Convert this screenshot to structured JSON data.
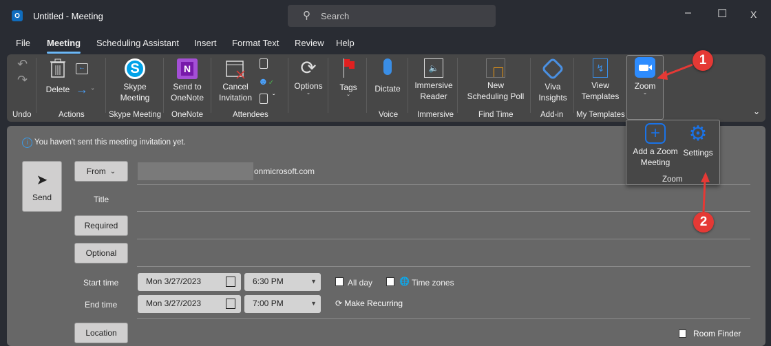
{
  "window": {
    "title": "Untitled  -  Meeting",
    "search_placeholder": "Search",
    "minimize": "–",
    "maximize": "☐",
    "close": "X"
  },
  "tabs": [
    {
      "label": "File"
    },
    {
      "label": "Meeting",
      "active": true
    },
    {
      "label": "Scheduling Assistant"
    },
    {
      "label": "Insert"
    },
    {
      "label": "Format Text"
    },
    {
      "label": "Review"
    },
    {
      "label": "Help"
    }
  ],
  "ribbon": {
    "groups": {
      "undo": "Undo",
      "actions": "Actions",
      "skype": "Skype Meeting",
      "onenote": "OneNote",
      "attendees": "Attendees",
      "voice": "Voice",
      "immersive": "Immersive",
      "findtime": "Find Time",
      "addin": "Add-in",
      "templates": "My Templates"
    },
    "buttons": {
      "delete": "Delete",
      "skype1": "Skype",
      "skype2": "Meeting",
      "onenote1": "Send to",
      "onenote2": "OneNote",
      "cancel1": "Cancel",
      "cancel2": "Invitation",
      "options": "Options",
      "tags": "Tags",
      "dictate": "Dictate",
      "immersive1": "Immersive",
      "immersive2": "Reader",
      "poll1": "New",
      "poll2": "Scheduling Poll",
      "viva1": "Viva",
      "viva2": "Insights",
      "tmpl1": "View",
      "tmpl2": "Templates",
      "zoom": "Zoom"
    },
    "zoom_dropdown": {
      "add1": "Add a Zoom",
      "add2": "Meeting",
      "settings": "Settings",
      "group": "Zoom"
    }
  },
  "form": {
    "info": "You haven't sent this meeting invitation yet.",
    "send": "Send",
    "from": "From",
    "from_value": "onmicrosoft.com",
    "title_label": "Title",
    "required": "Required",
    "optional": "Optional",
    "start_label": "Start time",
    "end_label": "End time",
    "start_date": "Mon 3/27/2023",
    "start_time": "6:30 PM",
    "end_date": "Mon 3/27/2023",
    "end_time": "7:00 PM",
    "all_day": "All day",
    "all_day_checked": false,
    "time_zones": "Time zones",
    "time_zones_checked": false,
    "recurring": "Make Recurring",
    "location": "Location",
    "room_finder": "Room Finder"
  },
  "annotations": {
    "one": "1",
    "two": "2",
    "color": "#e53935"
  }
}
